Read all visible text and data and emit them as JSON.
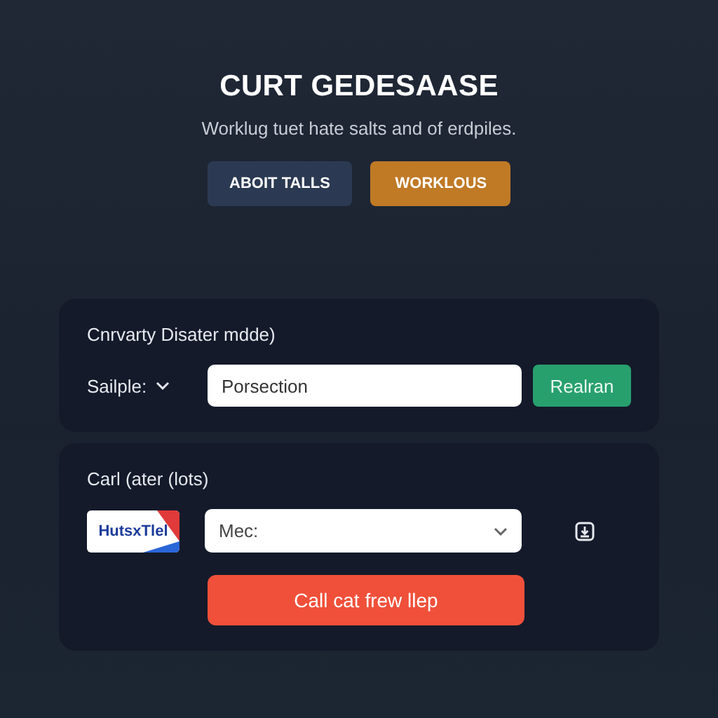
{
  "header": {
    "title": "CURT GEDESAASE",
    "subtitle": "Worklug tuet hate salts and of erdpiles."
  },
  "header_buttons": [
    {
      "label": "ABOIT TALLS",
      "kind": "secondary"
    },
    {
      "label": "WORKLOUS",
      "kind": "primary"
    }
  ],
  "search_card": {
    "heading": "Cnrvarty Disater mdde)",
    "dropdown": {
      "label": "Sailple:"
    },
    "field": {
      "value": "Porsection"
    },
    "button": "Realran"
  },
  "call_card": {
    "heading": "Carl (ater (lots)",
    "logo": {
      "text": "HutsxTlel"
    },
    "select": {
      "value": "Mec:"
    },
    "button": "Call cat frew llep"
  }
}
